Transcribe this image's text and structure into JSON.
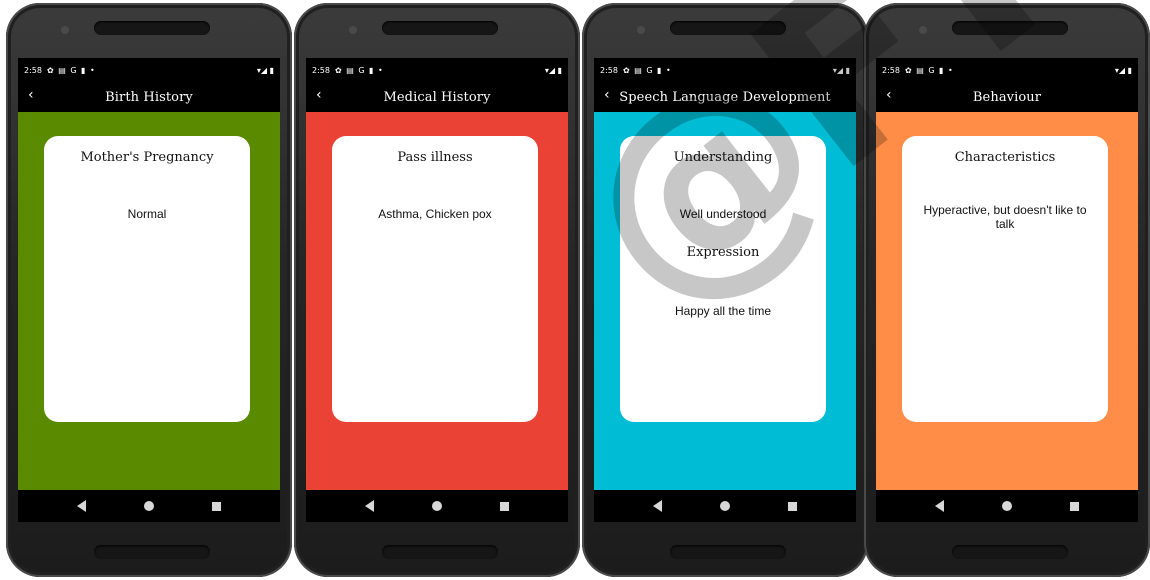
{
  "status": {
    "time": "2:58",
    "icons": "✿ ▤ G ▮ •",
    "signal": "▾◢ ▮"
  },
  "watermark": "@FTSM",
  "screens": [
    {
      "accent": "#5a8a00",
      "title": "Birth History",
      "card": {
        "heading": "Mother's Pregnancy",
        "value": "Normal"
      }
    },
    {
      "accent": "#ea4335",
      "title": "Medical History",
      "card": {
        "heading": "Pass illness",
        "value": "Asthma, Chicken pox"
      }
    },
    {
      "accent": "#00bcd4",
      "title": "Speech Language Development",
      "card": {
        "heading": "Understanding",
        "value": "Well understood",
        "heading2": "Expression",
        "value2": "Happy all the time"
      }
    },
    {
      "accent": "#ff8c47",
      "title": "Behaviour",
      "card": {
        "heading": "Characteristics",
        "value": "Hyperactive, but doesn't like to talk"
      }
    }
  ]
}
